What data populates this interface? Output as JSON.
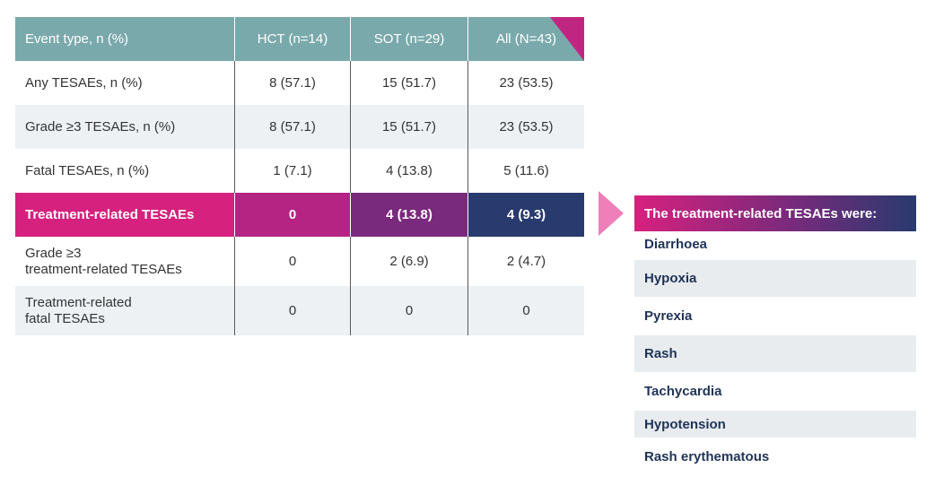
{
  "table": {
    "header": [
      "Event type, n (%)",
      "HCT (n=14)",
      "SOT (n=29)",
      "All (N=43)"
    ],
    "rows": [
      {
        "label": "Any TESAEs, n (%)",
        "hct": "8 (57.1)",
        "sot": "15 (51.7)",
        "all": "23 (53.5)"
      },
      {
        "label": "Grade ≥3 TESAEs, n (%)",
        "hct": "8 (57.1)",
        "sot": "15 (51.7)",
        "all": "23 (53.5)"
      },
      {
        "label": "Fatal TESAEs, n (%)",
        "hct": "1 (7.1)",
        "sot": "4 (13.8)",
        "all": "5 (11.6)"
      },
      {
        "label": "Treatment-related TESAEs",
        "hct": "0",
        "sot": "4 (13.8)",
        "all": "4 (9.3)"
      },
      {
        "label_line1": "Grade ≥3",
        "label_line2": "treatment-related TESAEs",
        "hct": "0",
        "sot": "2 (6.9)",
        "all": "2 (4.7)"
      },
      {
        "label_line1": "Treatment-related",
        "label_line2": "fatal TESAEs",
        "hct": "0",
        "sot": "0",
        "all": "0"
      }
    ]
  },
  "callout": {
    "title": "The treatment-related TESAEs were:",
    "items": [
      "Diarrhoea",
      "Hypoxia",
      "Pyrexia",
      "Rash",
      "Tachycardia",
      "Hypotension",
      "Rash erythematous"
    ]
  },
  "colors": {
    "header_teal": "#7aa9ac",
    "highlight_pink": "#d6217e",
    "highlight_purple": "#7a2a7c",
    "highlight_navy": "#283a6e",
    "arrow_pink": "#ee7fb8"
  }
}
